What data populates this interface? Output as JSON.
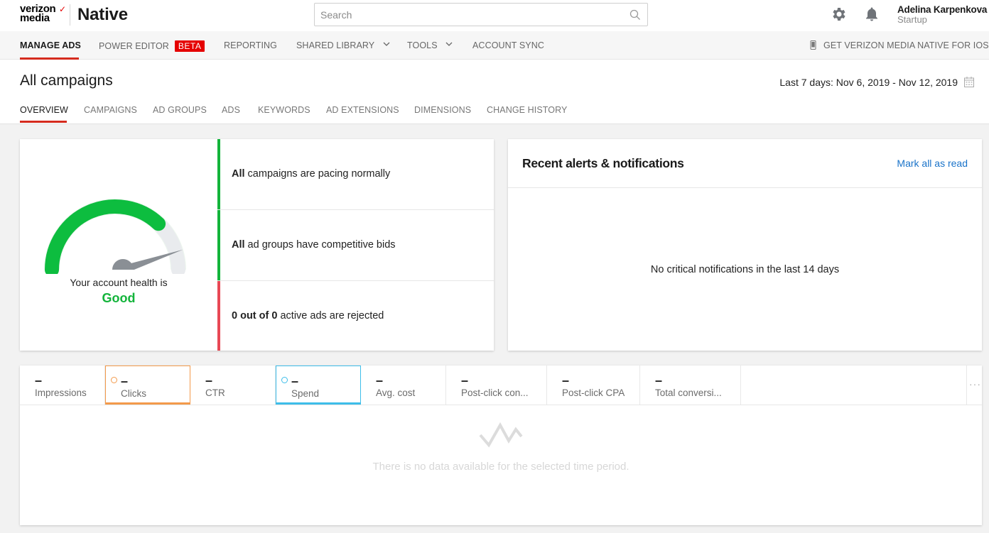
{
  "brand": {
    "logo_line1": "verizon",
    "logo_line2": "media",
    "logo_check": "✓",
    "product": "Native"
  },
  "search": {
    "placeholder": "Search",
    "value": ""
  },
  "user": {
    "name": "Adelina Karpenkova",
    "plan": "Startup"
  },
  "mainnav": {
    "items": [
      {
        "label": "MANAGE ADS",
        "active": true
      },
      {
        "label": "POWER EDITOR",
        "badge": "BETA"
      },
      {
        "label": "REPORTING"
      },
      {
        "label": "SHARED LIBRARY"
      },
      {
        "label": "TOOLS"
      },
      {
        "label": "ACCOUNT SYNC"
      }
    ],
    "ios_link": "GET VERIZON MEDIA NATIVE FOR IOS"
  },
  "page": {
    "title": "All campaigns",
    "daterange": "Last 7 days: Nov 6, 2019 - Nov 12, 2019",
    "tabs": [
      "OVERVIEW",
      "CAMPAIGNS",
      "AD GROUPS",
      "ADS",
      "KEYWORDS",
      "AD EXTENSIONS",
      "DIMENSIONS",
      "CHANGE HISTORY"
    ]
  },
  "health": {
    "label": "Your account health is",
    "value": "Good",
    "gauge_level": 0.95,
    "rows": [
      {
        "bold": "All",
        "text": " campaigns are pacing normally",
        "color": "#13b43b"
      },
      {
        "bold": "All",
        "text": " ad groups have competitive bids",
        "color": "#13b43b"
      },
      {
        "bold": "0 out of 0",
        "text": " active ads are rejected",
        "color": "#e84855"
      }
    ]
  },
  "alerts": {
    "title": "Recent alerts & notifications",
    "mark_all": "Mark all as read",
    "empty": "No critical notifications in the last 14 days"
  },
  "metrics": {
    "items": [
      {
        "value": "–",
        "label": "Impressions"
      },
      {
        "value": "–",
        "label": "Clicks"
      },
      {
        "value": "–",
        "label": "CTR"
      },
      {
        "value": "–",
        "label": "Spend"
      },
      {
        "value": "–",
        "label": "Avg. cost"
      },
      {
        "value": "–",
        "label": "Post-click con..."
      },
      {
        "value": "–",
        "label": "Post-click CPA"
      },
      {
        "value": "–",
        "label": "Total conversi..."
      }
    ],
    "more": "···",
    "empty": "There is no data available for the selected time period."
  },
  "colors": {
    "accent_red": "#d52b1e",
    "good_green": "#13b43b",
    "link_blue": "#1a73c9",
    "orange": "#f39a4b",
    "cyan": "#3dbde9"
  }
}
